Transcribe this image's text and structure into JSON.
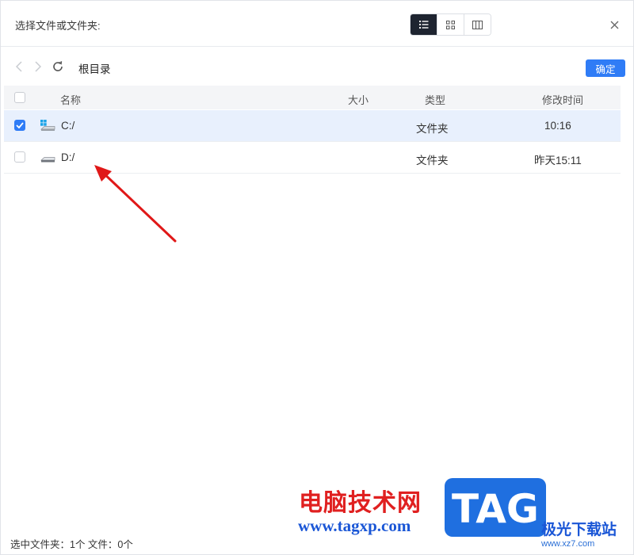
{
  "dialog": {
    "title": "选择文件或文件夹:",
    "view_modes": [
      {
        "name": "list",
        "active": true
      },
      {
        "name": "grid",
        "active": false
      },
      {
        "name": "columns",
        "active": false
      }
    ]
  },
  "navbar": {
    "breadcrumb": "根目录",
    "confirm_label": "确定"
  },
  "table": {
    "columns": {
      "name": "名称",
      "size": "大小",
      "type": "类型",
      "modified": "修改时间"
    },
    "rows": [
      {
        "name": "C:/",
        "size": "",
        "type": "文件夹",
        "modified": "10:16",
        "checked": true
      },
      {
        "name": "D:/",
        "size": "",
        "type": "文件夹",
        "modified": "昨天15:11",
        "checked": false
      }
    ]
  },
  "status": {
    "text": "选中文件夹：1个 文件：0个"
  },
  "watermark": {
    "title": "电脑技术网",
    "url": "www.tagxp.com",
    "logo_text": "TAG",
    "site_name": "极光下载站",
    "site_url": "www.xz7.com"
  },
  "colors": {
    "accent": "#2f7cf6",
    "active_view": "#1e2430",
    "selected_row": "#e8f0fd",
    "arrow": "#e01818"
  }
}
